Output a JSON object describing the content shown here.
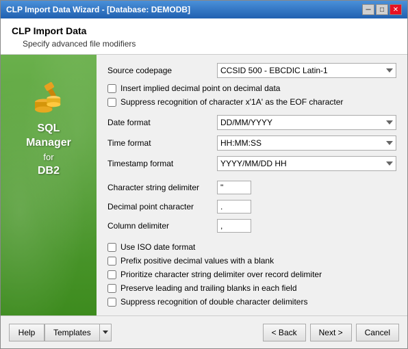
{
  "window": {
    "title": "CLP Import Data Wizard - [Database: DEMODB]",
    "minimize_btn": "─",
    "maximize_btn": "□",
    "close_btn": "✕"
  },
  "header": {
    "title": "CLP Import Data",
    "subtitle": "Specify advanced file modifiers"
  },
  "sidebar": {
    "line1": "SQL",
    "line2": "Manager",
    "line3": "for",
    "line4": "DB2"
  },
  "form": {
    "source_codepage_label": "Source codepage",
    "source_codepage_value": "CCSID 500 - EBCDIC Latin-1",
    "implied_decimal_label": "Insert implied decimal point on decimal data",
    "eof_char_label": "Suppress recognition of character x'1A' as the EOF character",
    "date_format_label": "Date format",
    "date_format_value": "DD/MM/YYYY",
    "time_format_label": "Time format",
    "time_format_value": "HH:MM:SS",
    "timestamp_format_label": "Timestamp format",
    "timestamp_format_value": "YYYY/MM/DD HH",
    "char_string_delim_label": "Character string delimiter",
    "char_string_delim_value": "\"",
    "decimal_point_label": "Decimal point character",
    "decimal_point_value": ".",
    "column_delim_label": "Column delimiter",
    "column_delim_value": ",",
    "iso_date_label": "Use ISO date format",
    "prefix_positive_label": "Prefix positive decimal values with a blank",
    "prioritize_char_label": "Prioritize character string delimiter over record delimiter",
    "preserve_blanks_label": "Preserve leading and trailing blanks in each field",
    "suppress_double_label": "Suppress recognition of double character delimiters"
  },
  "footer": {
    "help_label": "Help",
    "templates_label": "Templates",
    "back_label": "< Back",
    "next_label": "Next >",
    "cancel_label": "Cancel"
  },
  "source_codepage_options": [
    "CCSID 500 - EBCDIC Latin-1"
  ],
  "date_format_options": [
    "DD/MM/YYYY"
  ],
  "time_format_options": [
    "HH:MM:SS"
  ],
  "timestamp_format_options": [
    "YYYY/MM/DD HH"
  ]
}
